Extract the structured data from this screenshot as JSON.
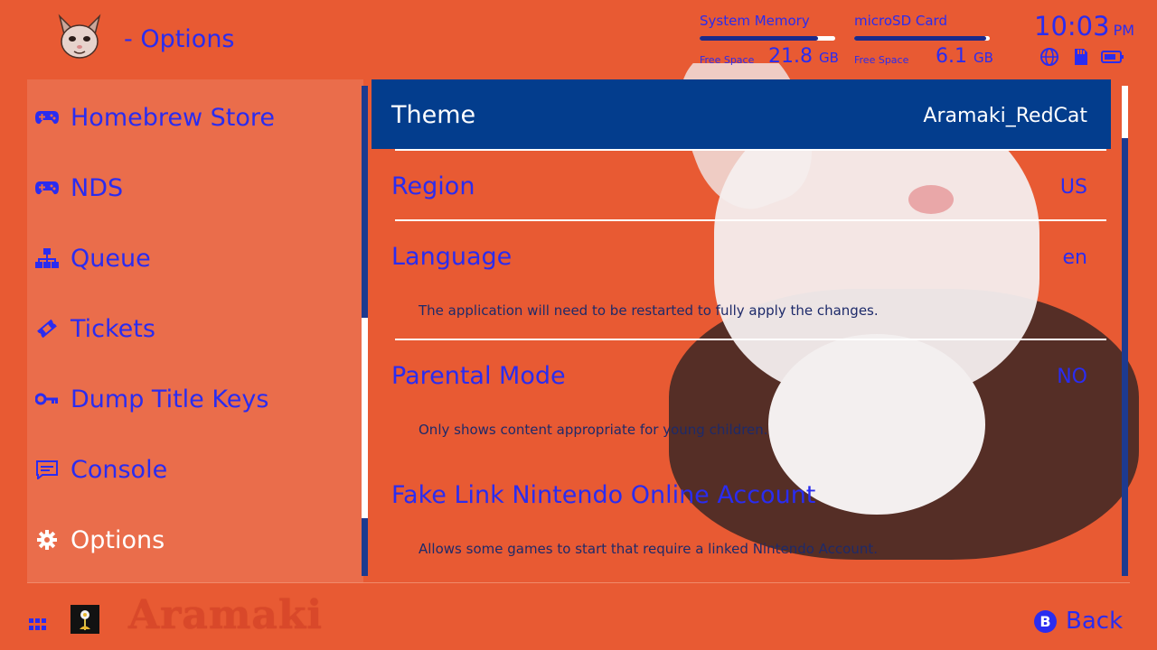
{
  "header": {
    "title": "- Options",
    "system_memory": {
      "label": "System Memory",
      "free_label": "Free Space",
      "value": "21.8",
      "unit": "GB",
      "used_fraction": 0.87
    },
    "microsd": {
      "label": "microSD Card",
      "free_label": "Free Space",
      "value": "6.1",
      "unit": "GB",
      "used_fraction": 0.97
    },
    "time": "10:03",
    "ampm": "PM"
  },
  "sidebar": {
    "items": [
      {
        "label": "Homebrew Store",
        "icon": "gamepad-icon",
        "active": false
      },
      {
        "label": "NDS",
        "icon": "gamepad-icon",
        "active": false
      },
      {
        "label": "Queue",
        "icon": "sitemap-icon",
        "active": false
      },
      {
        "label": "Tickets",
        "icon": "ticket-icon",
        "active": false
      },
      {
        "label": "Dump Title Keys",
        "icon": "key-icon",
        "active": false
      },
      {
        "label": "Console",
        "icon": "console-icon",
        "active": false
      },
      {
        "label": "Options",
        "icon": "gear-icon",
        "active": true
      }
    ]
  },
  "options": [
    {
      "label": "Theme",
      "value": "Aramaki_RedCat",
      "selected": true
    },
    {
      "label": "Region",
      "value": "US"
    },
    {
      "label": "Language",
      "value": "en",
      "description": "The application will need to be restarted to fully apply the changes."
    },
    {
      "label": "Parental Mode",
      "value": "NO",
      "description": "Only shows content appropriate for young children."
    },
    {
      "label": "Fake Link Nintendo Online Account",
      "value": "",
      "description": "Allows some games to start that require a linked Nintendo Account."
    }
  ],
  "footer": {
    "brand": "Aramaki",
    "back_button": "B",
    "back_label": "Back"
  },
  "colors": {
    "background": "#e85a33",
    "sidebar": "#ea6d4b",
    "selected_row": "#033d8d",
    "accent_text": "#2a2cf0"
  }
}
